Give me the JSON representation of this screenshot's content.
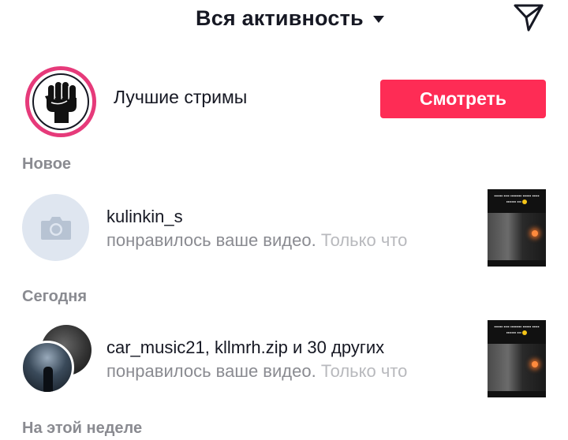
{
  "header": {
    "title": "Вся активность",
    "caret_icon": "caret-down-icon",
    "send_icon": "paper-plane-icon"
  },
  "live": {
    "label": "Лучшие стримы",
    "avatar_icon": "raised-fist-icon",
    "watch_button": "Смотреть",
    "ring_color": "#e63a7a",
    "button_color": "#fe2c55"
  },
  "sections": {
    "new": "Новое",
    "today": "Сегодня",
    "this_week": "На этой неделе"
  },
  "notifications": [
    {
      "user": "kulinkin_s",
      "action": "понравилось ваше видео.",
      "time": "Только что",
      "avatar_icon": "camera-icon"
    },
    {
      "users_part1": "car_music21",
      "comma": ",",
      "users_part2": "kllmrh.zip",
      "and_word": "и",
      "others": "30 других",
      "action": "понравилось ваше видео.",
      "time": "Только что",
      "avatar_icon": "group-avatar"
    }
  ]
}
